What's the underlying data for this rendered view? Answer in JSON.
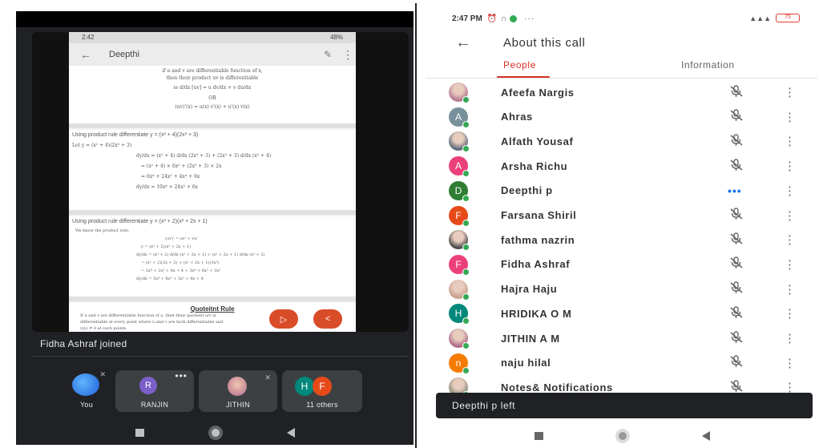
{
  "left": {
    "shared_screen": {
      "status_time": "2:42",
      "status_battery": "48%",
      "app_title": "Deepthi",
      "card1_lines": [
        "if u and v are differentiable function of x,",
        "then their product uv is differentiable",
        "ie d/dx [uv] = u dv/dx + v du/dx",
        "OR",
        "(uv)'(x) = u(x) v'(x) + u'(x) v(x)"
      ],
      "card2_heading": "Using product rule differentiate y = (x² + 4)(2x³ + 3)",
      "card2_lines": [
        "Let      y = (x² + 4)(2x³ + 3)",
        "dy/dx = (x² + 4) d/dx (2x³ + 3) + (2x³ + 3) d/dx (x² + 4)",
        "= (x² + 4) × 6x² + (2x³ + 3) × 2x",
        "= 6x⁴ + 24x² + 4x⁴ + 6x",
        "dy/dx = 10x⁴ + 24x² + 6x"
      ],
      "card3_heading": "Using product rule differentiate y = (x³ + 2)(x² + 2x + 1)",
      "card3_lines": [
        "We know the product rule,",
        "(uv)' = uv' + vu'",
        "y = (x³ + 2)(x² + 2x + 1)",
        "dy/dx = (x³ + 2) d/dx (x² + 2x + 1) + (x² + 2x + 1) d/dx (x³ + 2)",
        "= (x³ + 2)(2x + 2) + (x² + 2x + 1)(3x²)",
        "= 2x⁴ + 2x³ + 4x + 4 + 3x⁴ + 6x³ + 3x²",
        "dy/dx = 5x⁴ + 8x³ + 3x² + 4x + 4"
      ],
      "card4_title": "Quoteitnt Rule",
      "card4_lines": [
        "If u and v are differentiable function of x, then their quotient u/v is",
        "differentiable at every point where u and v are both differentiable and",
        "v(x) ≠ 0 at such points"
      ]
    },
    "join_message": "Fidha Ashraf joined",
    "tiles": [
      {
        "label": "You"
      },
      {
        "label": "RANJIN",
        "initial": "R"
      },
      {
        "label": "JITHIN"
      },
      {
        "label": "11 others",
        "initials": [
          "H",
          "F"
        ]
      }
    ]
  },
  "right": {
    "status_time": "2:47 PM",
    "status_icons": "⏰ ∩",
    "status_more": "···",
    "battery": "75",
    "title": "About this call",
    "tabs": {
      "people": "People",
      "information": "Information"
    },
    "participants": [
      {
        "name": "Afeefa Nargis",
        "avatar": "photo",
        "color": "#b77a8f",
        "status": "muted"
      },
      {
        "name": "Ahras",
        "initial": "A",
        "color": "#78909c",
        "status": "muted"
      },
      {
        "name": "Alfath Yousaf",
        "avatar": "photo",
        "color": "#5d6b7a",
        "status": "muted"
      },
      {
        "name": "Arsha Richu",
        "initial": "A",
        "color": "#ec407a",
        "status": "muted"
      },
      {
        "name": "Deepthi p",
        "initial": "D",
        "color": "#2e7d32",
        "status": "speaking"
      },
      {
        "name": "Farsana Shiril",
        "initial": "F",
        "color": "#e64a19",
        "status": "muted"
      },
      {
        "name": "fathma nazrin",
        "avatar": "photo",
        "color": "#4a4a4a",
        "status": "muted"
      },
      {
        "name": "Fidha Ashraf",
        "initial": "F",
        "color": "#ec407a",
        "status": "muted"
      },
      {
        "name": "Hajra Haju",
        "avatar": "photo",
        "color": "#c9a08c",
        "status": "muted"
      },
      {
        "name": "HRIDIKA O M",
        "initial": "H",
        "color": "#00897b",
        "status": "muted"
      },
      {
        "name": "JITHIN A M",
        "avatar": "photo",
        "color": "#b06a8a",
        "status": "muted"
      },
      {
        "name": "naju hilal",
        "initial": "n",
        "color": "#f57c00",
        "status": "muted"
      },
      {
        "name": "Notes& Notifications",
        "avatar": "photo",
        "color": "#8a8a7a",
        "status": "muted"
      }
    ],
    "snackbar": "Deepthi p left",
    "icons": {
      "mic_off": "🎙̸",
      "more": "⋮",
      "speaking": "•••"
    }
  }
}
